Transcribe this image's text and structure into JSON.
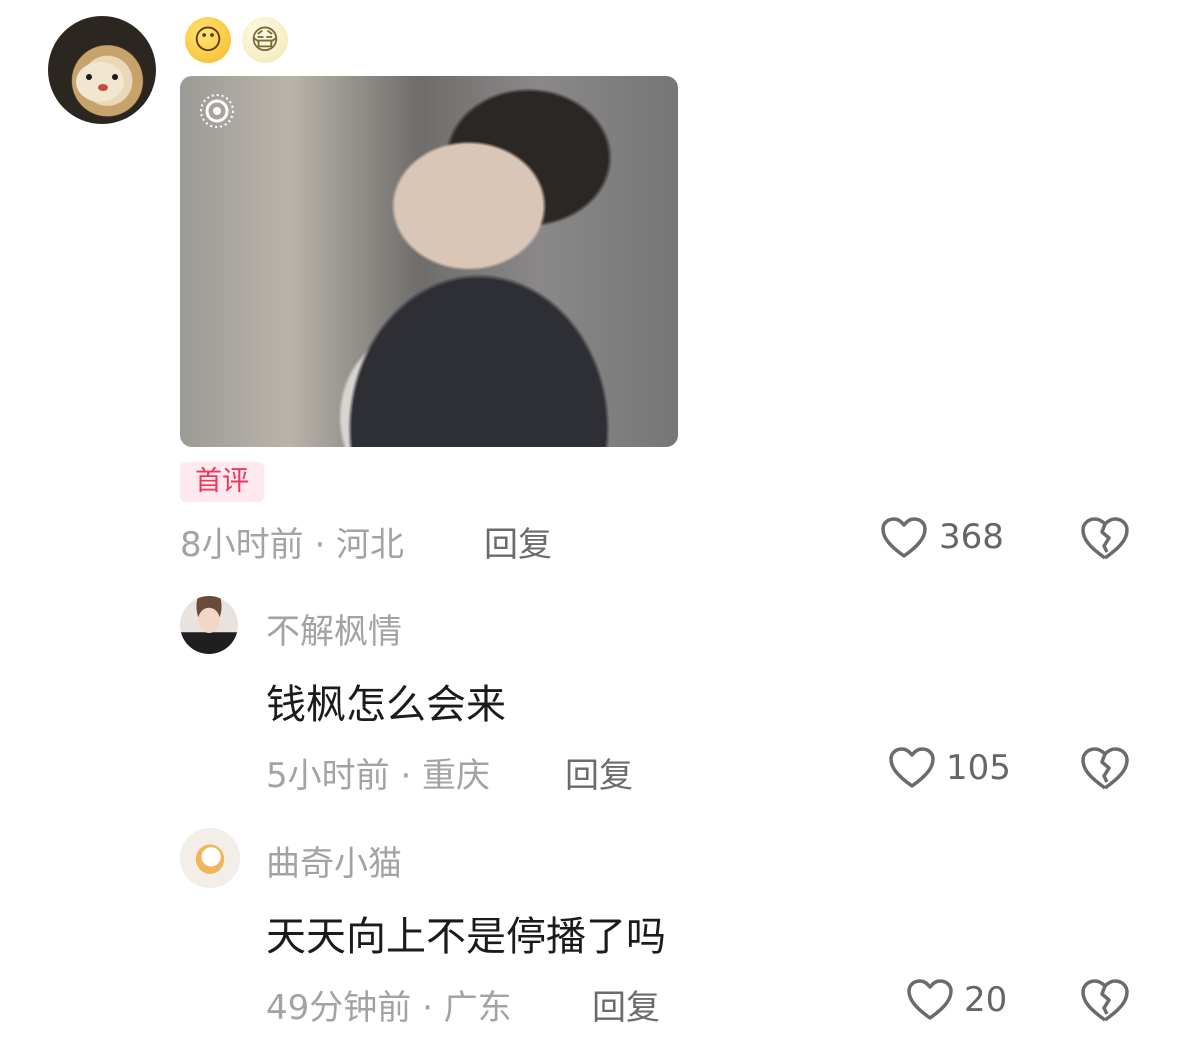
{
  "comment": {
    "emoji_1": "😶",
    "emoji_2": "😷",
    "badge": "首评",
    "meta": "8小时前 · 河北",
    "reply_label": "回复",
    "likes": "368"
  },
  "replies": [
    {
      "username": "不解枫情",
      "text": "钱枫怎么会来",
      "meta": "5小时前 · 重庆",
      "reply_label": "回复",
      "likes": "105"
    },
    {
      "username": "曲奇小猫",
      "text": "天天向上不是停播了吗",
      "meta": "49分钟前 · 广东",
      "reply_label": "回复",
      "likes": "20"
    }
  ],
  "colors": {
    "badge_text": "#f0365f",
    "badge_bg": "#fde9ee",
    "meta_gray": "#a3a3a3"
  },
  "icons": [
    "live-photo-icon",
    "heart-outline-icon",
    "broken-heart-icon"
  ]
}
